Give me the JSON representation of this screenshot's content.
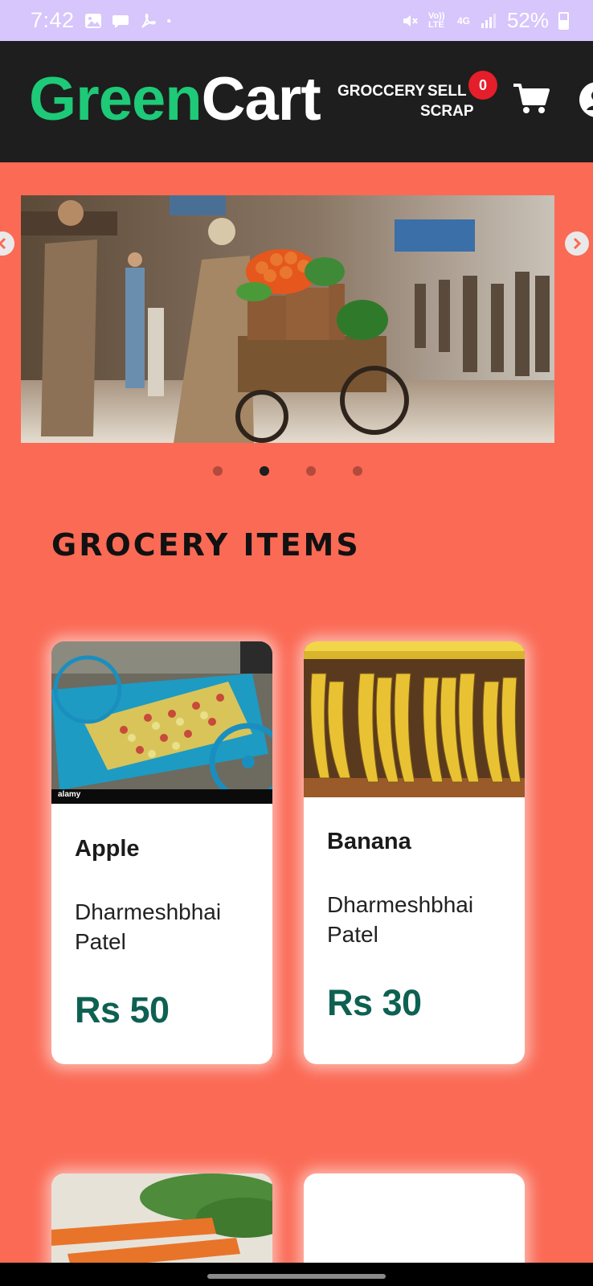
{
  "status_bar": {
    "time": "7:42",
    "battery": "52%",
    "icons": [
      "gallery-icon",
      "chat-icon",
      "pdf-icon",
      "dot-icon",
      "mute-icon",
      "volte-icon",
      "4g-icon",
      "signal-icon",
      "battery-icon"
    ],
    "volte_label": "Vo)) LTE",
    "network_label": "4G"
  },
  "header": {
    "logo_part1": "Green",
    "logo_part2": "Cart",
    "nav_grocery": "GROCCERY",
    "nav_sell": "SELL",
    "nav_scrap": "SCRAP",
    "cart_count": "0",
    "colors": {
      "brand_green": "#1ec977",
      "header_bg": "#1e1e1e",
      "badge_red": "#e41e2a"
    }
  },
  "carousel": {
    "slides": 4,
    "active_slide": 2,
    "prev_icon": "chevron-left-icon",
    "next_icon": "chevron-right-icon"
  },
  "section": {
    "title": "GROCERY ITEMS"
  },
  "products": [
    {
      "name": "Apple",
      "seller": "Dharmeshbhai Patel",
      "price": "Rs 50",
      "watermark": "alamy"
    },
    {
      "name": "Banana",
      "seller": "Dharmeshbhai Patel",
      "price": "Rs 30"
    },
    {
      "name": "",
      "seller": "",
      "price": ""
    },
    {
      "name": "",
      "seller": "",
      "price": ""
    }
  ],
  "colors": {
    "page_bg": "#fb6a55",
    "price_color": "#0e6152"
  }
}
